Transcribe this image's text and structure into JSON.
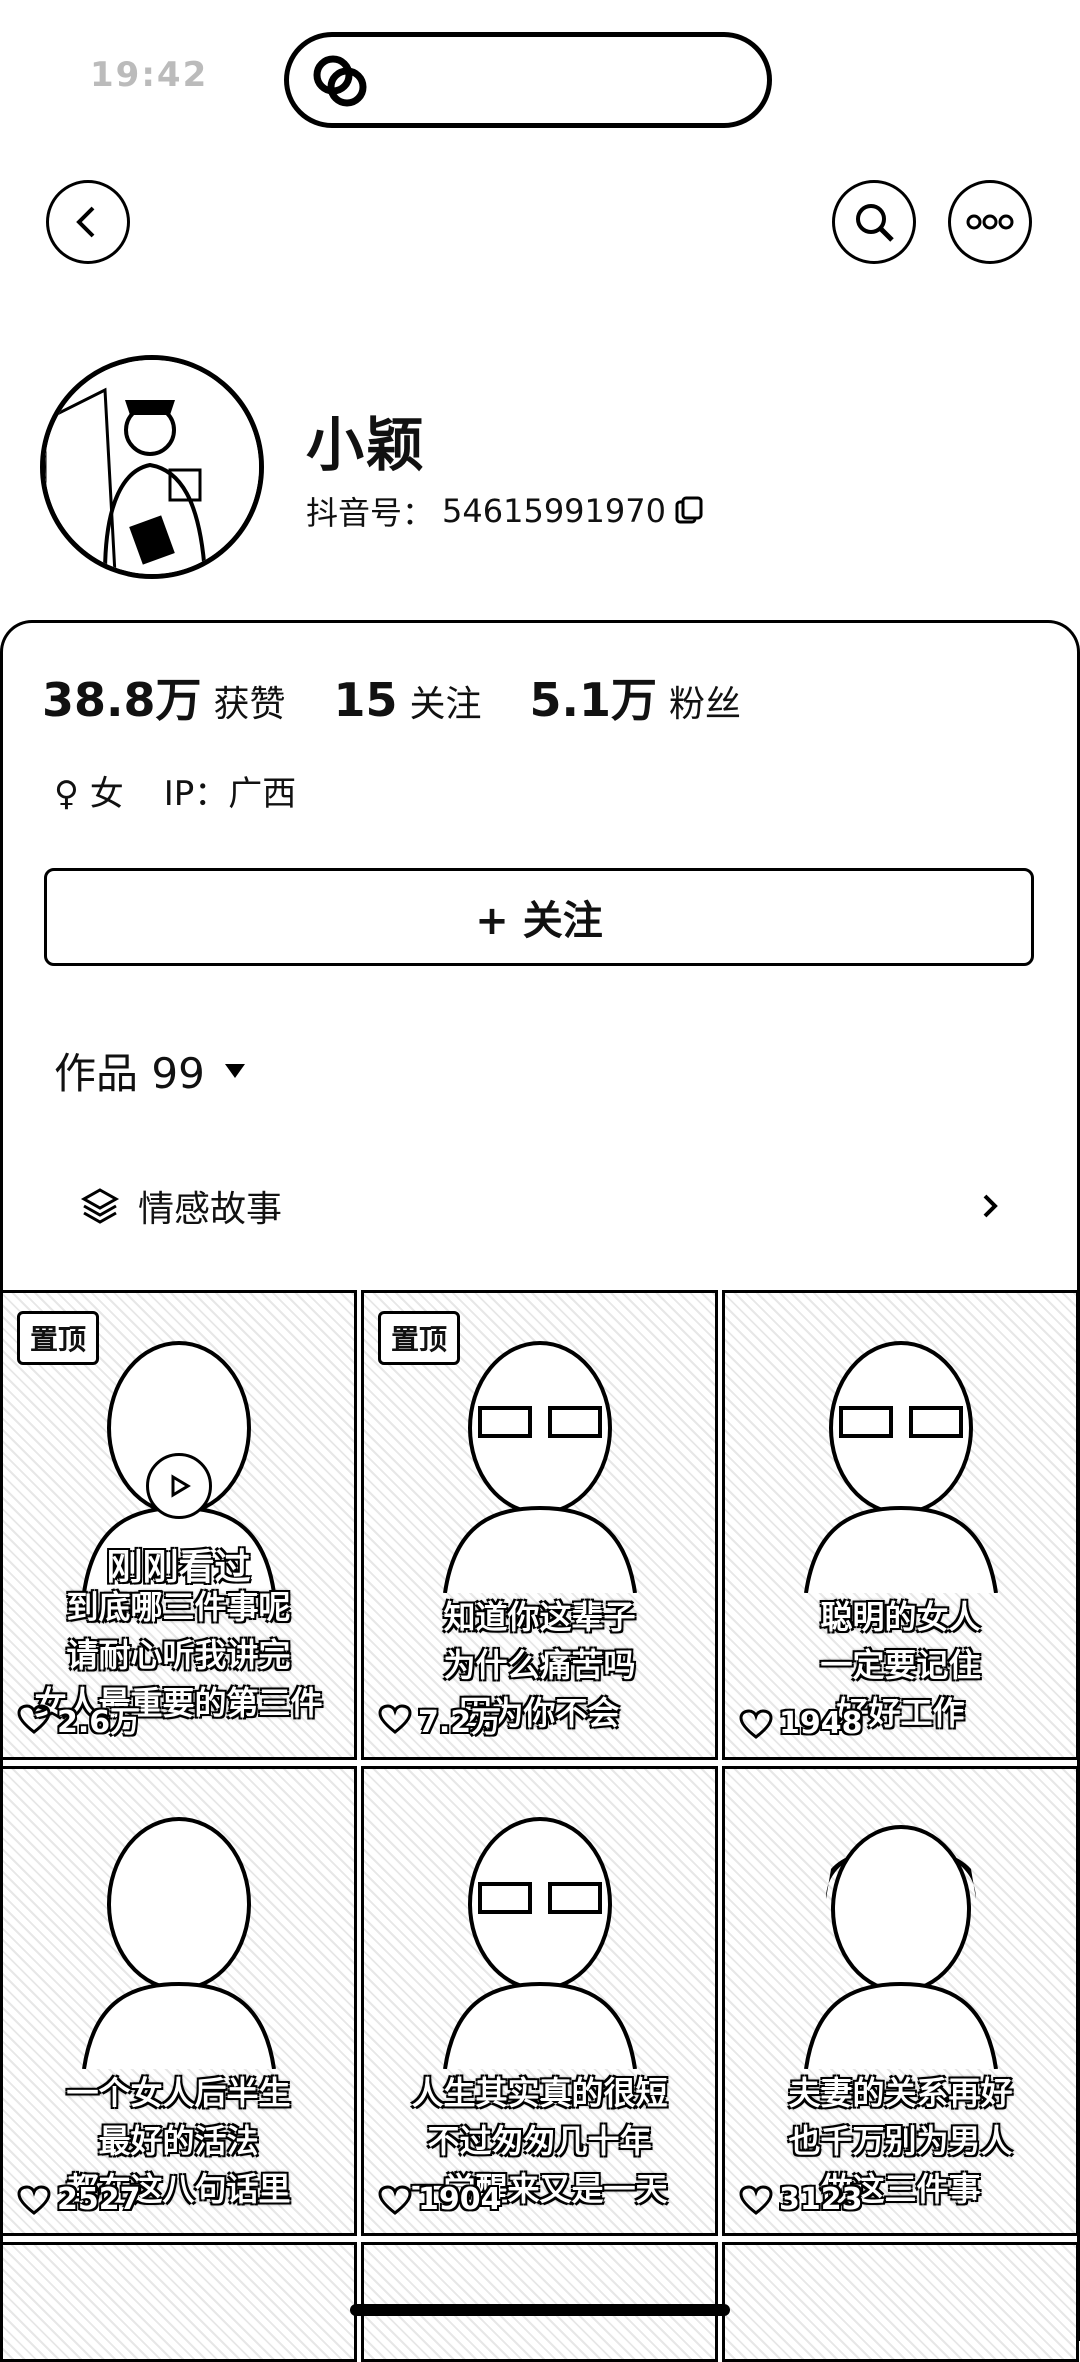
{
  "status_bar": {
    "time": "19:42"
  },
  "profile": {
    "nickname": "小颖",
    "douyin_id_label": "抖音号：",
    "douyin_id": "54615991970"
  },
  "stats": [
    {
      "value": "38.8万",
      "label": "获赞"
    },
    {
      "value": "15",
      "label": "关注"
    },
    {
      "value": "5.1万",
      "label": "粉丝"
    }
  ],
  "meta": {
    "gender": "♀ 女",
    "ip": "IP：广西"
  },
  "follow_button": {
    "label": "+ 关注"
  },
  "works_tab": {
    "label": "作品 99"
  },
  "collection": {
    "label": "情感故事"
  },
  "videos": [
    {
      "pinned": "置顶",
      "caption_lines": [
        "到底哪三件事呢",
        "请耐心听我讲完",
        "女人最重要的第三件"
      ],
      "likes": "2.6万",
      "just_watched": "刚刚看过"
    },
    {
      "pinned": "置顶",
      "caption_lines": [
        "知道你这辈子",
        "为什么痛苦吗",
        "因为你不会"
      ],
      "likes": "7.2万"
    },
    {
      "caption_lines": [
        "聪明的女人",
        "一定要记住",
        "好好工作"
      ],
      "likes": "1948"
    },
    {
      "caption_lines": [
        "一个女人后半生",
        "最好的活法",
        "都在这八句话里"
      ],
      "likes": "2527"
    },
    {
      "caption_lines": [
        "人生其实真的很短",
        "不过匆匆几十年",
        "一觉醒来又是一天"
      ],
      "likes": "1904"
    },
    {
      "caption_lines": [
        "夫妻的关系再好",
        "也千万别为男人",
        "做这三件事"
      ],
      "likes": "3123"
    }
  ],
  "colors": {
    "text": "#111111",
    "background": "#ffffff"
  }
}
